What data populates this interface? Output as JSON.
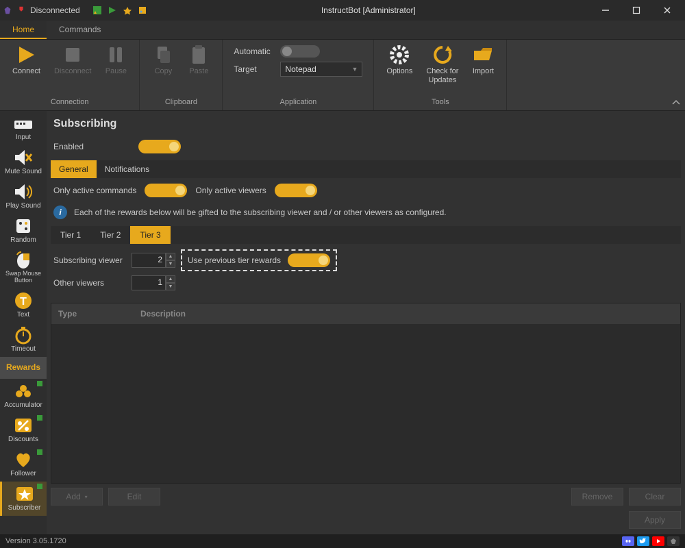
{
  "window": {
    "title": "InstructBot [Administrator]",
    "status": "Disconnected"
  },
  "menu": {
    "home": "Home",
    "commands": "Commands"
  },
  "ribbon": {
    "connect": "Connect",
    "disconnect": "Disconnect",
    "pause": "Pause",
    "grp_connection": "Connection",
    "copy": "Copy",
    "paste": "Paste",
    "grp_clipboard": "Clipboard",
    "automatic": "Automatic",
    "target": "Target",
    "target_value": "Notepad",
    "grp_application": "Application",
    "options": "Options",
    "check": "Check for\nUpdates",
    "import": "Import",
    "grp_tools": "Tools"
  },
  "sidebar": {
    "input": "Input",
    "mute": "Mute Sound",
    "play": "Play Sound",
    "random": "Random",
    "swap": "Swap Mouse Button",
    "text": "Text",
    "timeout": "Timeout",
    "rewards": "Rewards",
    "accumulator": "Accumulator",
    "discounts": "Discounts",
    "follower": "Follower",
    "subscriber": "Subscriber"
  },
  "page": {
    "title": "Subscribing",
    "enabled": "Enabled",
    "tab_general": "General",
    "tab_notifications": "Notifications",
    "only_active_commands": "Only active commands",
    "only_active_viewers": "Only active viewers",
    "info": "Each of the rewards below will be gifted to the subscribing viewer and / or other viewers as configured.",
    "tier1": "Tier 1",
    "tier2": "Tier 2",
    "tier3": "Tier 3",
    "subscribing_viewer": "Subscribing viewer",
    "subscribing_viewer_value": "2",
    "use_previous": "Use previous tier rewards",
    "other_viewers": "Other viewers",
    "other_viewers_value": "1",
    "col_type": "Type",
    "col_description": "Description",
    "btn_add": "Add",
    "btn_edit": "Edit",
    "btn_remove": "Remove",
    "btn_clear": "Clear",
    "btn_apply": "Apply"
  },
  "status": {
    "version": "Version 3.05.1720"
  }
}
